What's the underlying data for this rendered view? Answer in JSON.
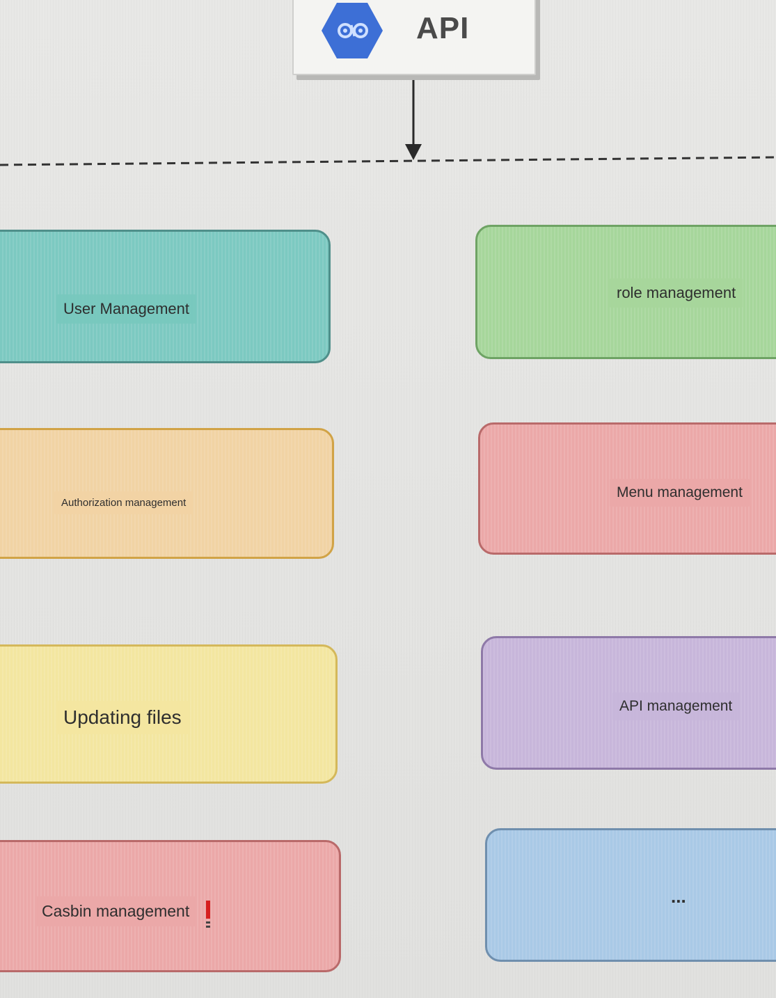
{
  "header": {
    "api_label": "API"
  },
  "modules": [
    {
      "id": "user-management",
      "label": "User Management",
      "color": "#7cc9c1",
      "border": "#4f8f8a",
      "column": "left"
    },
    {
      "id": "role-management",
      "label": "role management",
      "color": "#a6d69b",
      "border": "#6ea364",
      "column": "right"
    },
    {
      "id": "authorization-management",
      "label": "Authorization management",
      "color": "#f1d3a4",
      "border": "#d1a346",
      "column": "left"
    },
    {
      "id": "menu-management",
      "label": "Menu management",
      "color": "#eba8a8",
      "border": "#b96a6a",
      "column": "right"
    },
    {
      "id": "updating-files",
      "label": "Updating files",
      "color": "#f3e6a0",
      "border": "#d4b85a",
      "column": "left"
    },
    {
      "id": "api-management",
      "label": "API management",
      "color": "#c7b6da",
      "border": "#8e79a8",
      "column": "right"
    },
    {
      "id": "casbin-management",
      "label": "Casbin management",
      "color": "#eba8a8",
      "border": "#b96a6a",
      "column": "left"
    },
    {
      "id": "more",
      "label": "...",
      "color": "#a9c9e6",
      "border": "#6f8fae",
      "column": "right"
    }
  ],
  "colors": {
    "background": "#e4e4e2",
    "logo_hex": "#3d6fd6",
    "arrow": "#2a2a2a"
  },
  "icons": {
    "api_logo": "hexagon-logo-icon",
    "warning": "exclamation-icon"
  }
}
